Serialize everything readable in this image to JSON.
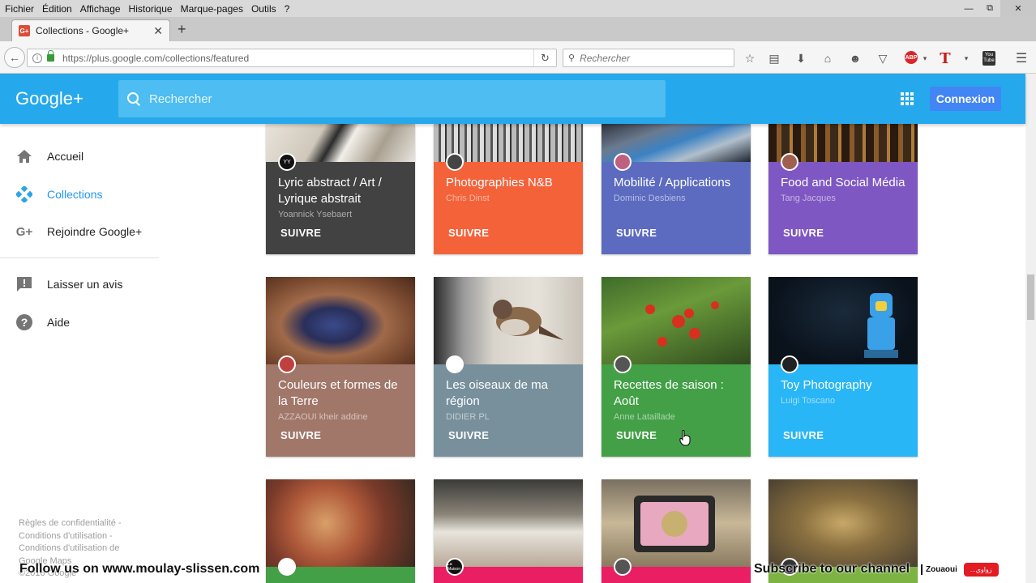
{
  "browser": {
    "menu": [
      "Fichier",
      "Édition",
      "Affichage",
      "Historique",
      "Marque-pages",
      "Outils",
      "?"
    ],
    "tab_title": "Collections - Google+",
    "tab_favicon": "G+",
    "url": "https://plus.google.com/collections/featured",
    "search_placeholder": "Rechercher",
    "toolbar_icons": [
      "star-icon",
      "reading-list-icon",
      "download-icon",
      "home-icon",
      "chat-icon",
      "pocket-icon",
      "adblock-icon",
      "t-extension-icon",
      "youtube-icon",
      "menu-icon"
    ]
  },
  "gplus": {
    "logo": "Google+",
    "search_placeholder": "Rechercher",
    "signin": "Connexion",
    "accent": "#25a9ec"
  },
  "sidebar": {
    "items": [
      {
        "label": "Accueil",
        "icon": "home-icon",
        "active": false
      },
      {
        "label": "Collections",
        "icon": "collections-icon",
        "active": true
      },
      {
        "label": "Rejoindre Google+",
        "icon": "gplus-icon",
        "active": false
      },
      {
        "label": "Laisser un avis",
        "icon": "feedback-icon",
        "active": false
      },
      {
        "label": "Aide",
        "icon": "help-icon",
        "active": false
      }
    ],
    "footer": [
      "Règles de confidentialité -",
      "Conditions d'utilisation -",
      "Conditions d'utilisation de",
      "Google Maps",
      "©2016 Google"
    ]
  },
  "follow_label": "SUIVRE",
  "collections": [
    {
      "title": "Lyric abstract / Art / Lyrique abstrait",
      "author": "Yoannick Ysebaert",
      "color": "#424242",
      "avatar": "YY"
    },
    {
      "title": "Photographies N&B",
      "author": "Chris Dinst",
      "color": "#f4623a",
      "avatar": ""
    },
    {
      "title": "Mobilité / Applications",
      "author": "Dominic Desbiens",
      "color": "#5c6bc0",
      "avatar": ""
    },
    {
      "title": "Food and Social Média",
      "author": "Tang Jacques",
      "color": "#7e57c2",
      "avatar": ""
    },
    {
      "title": "Couleurs et formes de la Terre",
      "author": "AZZAOUI kheir addine",
      "color": "#a1776a",
      "avatar": ""
    },
    {
      "title": "Les oiseaux de ma région",
      "author": "DIDIER PL",
      "color": "#78909c",
      "avatar": ""
    },
    {
      "title": "Recettes de saison : Août",
      "author": "Anne Lataillade",
      "color": "#43a047",
      "avatar": ""
    },
    {
      "title": "Toy Photography",
      "author": "Luigi Toscano",
      "color": "#29b6f6",
      "avatar": ""
    },
    {
      "title": "",
      "author": "",
      "color": "#43a047",
      "avatar": ""
    },
    {
      "title": "",
      "author": "",
      "color": "#e91e63",
      "avatar": "La Maison"
    },
    {
      "title": "",
      "author": "",
      "color": "#e91e63",
      "avatar": ""
    },
    {
      "title": "",
      "author": "",
      "color": "#7cb342",
      "avatar": ""
    }
  ],
  "overlay": {
    "follow_text": "Follow us on  www.moulay-slissen.com",
    "subscribe_text": "Subscribe to our channel",
    "badge_name": "Zouaoui",
    "badge_red": "...زواوي"
  }
}
